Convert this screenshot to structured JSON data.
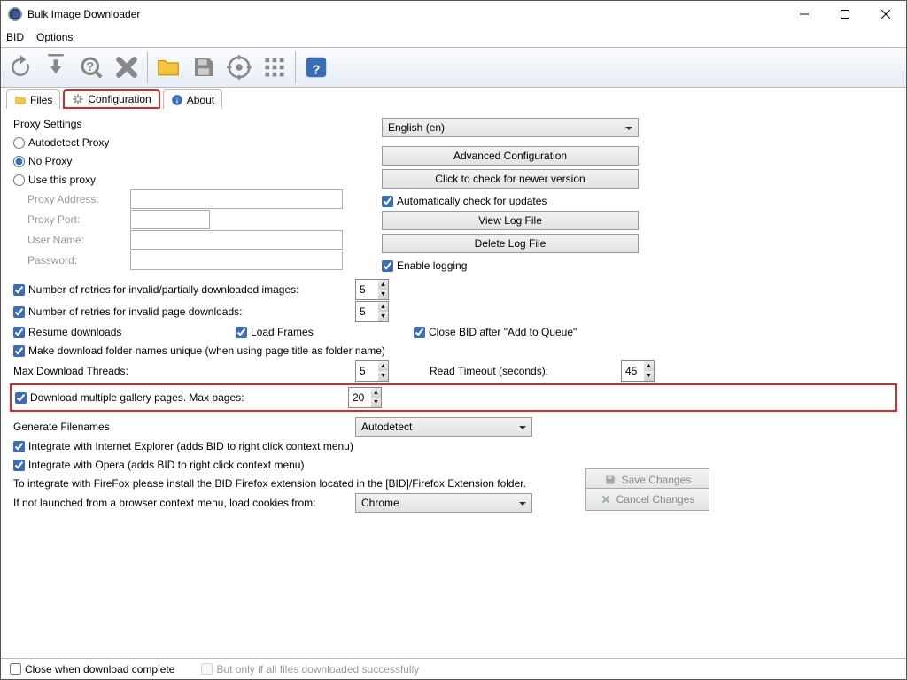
{
  "window": {
    "title": "Bulk Image Downloader"
  },
  "menu": {
    "bid": "BID",
    "options": "Options"
  },
  "tabs": {
    "files": "Files",
    "configuration": "Configuration",
    "about": "About"
  },
  "proxy": {
    "title": "Proxy Settings",
    "autodetect": "Autodetect Proxy",
    "noproxy": "No Proxy",
    "usethis": "Use this proxy",
    "address": "Proxy Address:",
    "port": "Proxy Port:",
    "user": "User Name:",
    "password": "Password:"
  },
  "language": {
    "selected": "English (en)"
  },
  "right": {
    "advanced": "Advanced Configuration",
    "checknewer": "Click to check for newer version",
    "autocheck": "Automatically check for updates",
    "viewlog": "View Log File",
    "deletelog": "Delete Log File",
    "enablelog": "Enable logging"
  },
  "retries": {
    "invalidimages": "Number of retries for invalid/partially downloaded images:",
    "invalidpages": "Number of retries for invalid page downloads:",
    "imgval": "5",
    "pageval": "5"
  },
  "opts": {
    "resume": "Resume downloads",
    "loadframes": "Load Frames",
    "closeafterqueue": "Close BID after \"Add to Queue\"",
    "uniquefolders": "Make download folder names unique (when using page title as folder name)"
  },
  "threads": {
    "label": "Max Download Threads:",
    "value": "5",
    "readtimeout_label": "Read Timeout (seconds):",
    "readtimeout_value": "45"
  },
  "multigallery": {
    "label": "Download multiple gallery pages. Max pages:",
    "value": "20"
  },
  "filenames": {
    "label": "Generate Filenames",
    "value": "Autodetect"
  },
  "integrate": {
    "ie": "Integrate with Internet Explorer (adds BID to right click context menu)",
    "opera": "Integrate with Opera (adds BID to right click context menu)",
    "firefox": "To integrate with FireFox please install the BID Firefox extension located in the [BID]/Firefox Extension folder."
  },
  "cookies": {
    "label": "If not launched from a browser context menu, load cookies from:",
    "value": "Chrome"
  },
  "actions": {
    "save": "Save Changes",
    "cancel": "Cancel Changes"
  },
  "footer": {
    "closewhendone": "Close when download complete",
    "onlyallfiles": "But only if all files downloaded successfully"
  }
}
